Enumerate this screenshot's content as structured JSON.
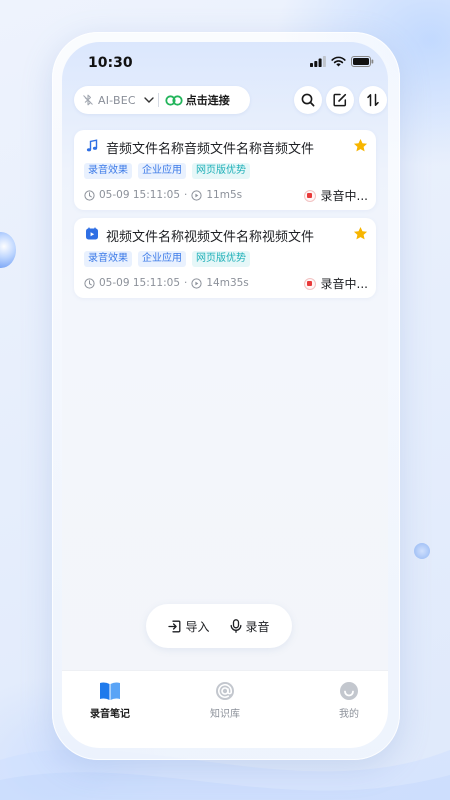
{
  "status_bar": {
    "time": "10:30"
  },
  "toolbar": {
    "device_name": "AI-BEC",
    "connect_label": "点击连接",
    "icons": [
      "search-icon",
      "edit-icon",
      "sort-icon"
    ]
  },
  "files": [
    {
      "type_icon": "music-note-icon",
      "title": "音频文件名称音频文件名称音频文件",
      "tags": [
        "录音效果",
        "企业应用",
        "网页版优势"
      ],
      "date": "05-09 15:11:05",
      "separator": "·",
      "duration": "11m5s",
      "status": "录音中..."
    },
    {
      "type_icon": "video-icon",
      "title": "视频文件名称视频文件名称视频文件",
      "tags": [
        "录音效果",
        "企业应用",
        "网页版优势"
      ],
      "date": "05-09 15:11:05",
      "separator": "·",
      "duration": "14m35s",
      "status": "录音中..."
    }
  ],
  "actions": {
    "import_label": "导入",
    "record_label": "录音"
  },
  "tabs": [
    {
      "label": "录音笔记",
      "icon": "book-icon",
      "active": true
    },
    {
      "label": "知识库",
      "icon": "at-icon",
      "active": false
    },
    {
      "label": "我的",
      "icon": "profile-icon",
      "active": false
    }
  ],
  "colors": {
    "accent": "#1f7aec",
    "star": "#f7b500",
    "tag_blue": "#3d7be8",
    "tag_cyan": "#1fb0b8",
    "recording_red": "#e83a3a",
    "connect_green": "#22b45a"
  }
}
